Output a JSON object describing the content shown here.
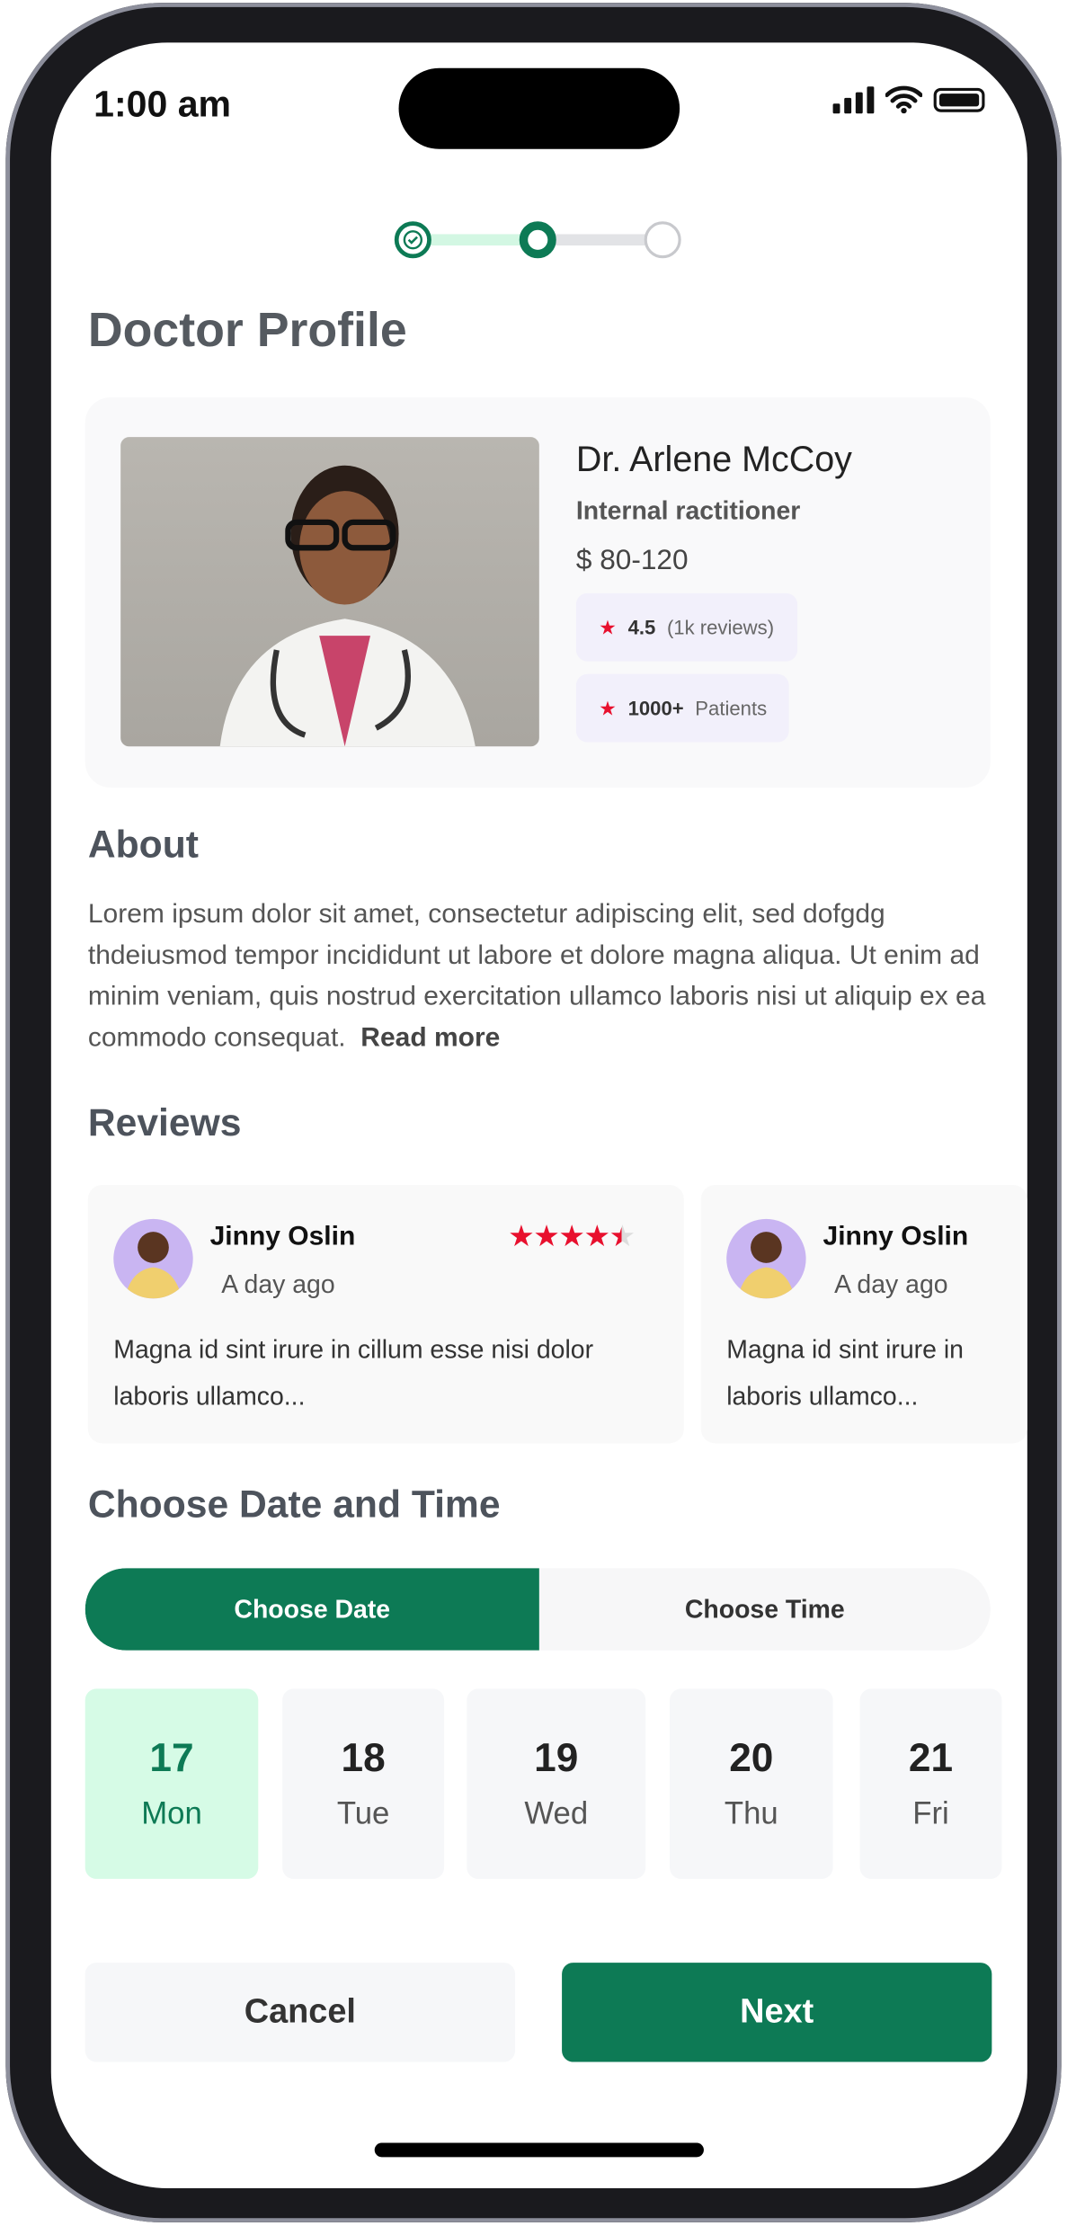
{
  "status_bar": {
    "time": "1:00 am"
  },
  "stepper": {
    "steps_total": 3,
    "current_step": 2,
    "accent": "#0d7a55"
  },
  "page": {
    "title": "Doctor Profile"
  },
  "doctor": {
    "name": "Dr. Arlene McCoy",
    "specialty": "Internal ractitioner",
    "price": "$ 80-120",
    "rating": "4.5",
    "reviews_label": "(1k reviews)",
    "patients": "1000+",
    "patients_label": "Patients"
  },
  "about": {
    "heading": "About",
    "text": "Lorem ipsum dolor sit amet, consectetur adipiscing elit, sed dofgdg thdeiusmod tempor incididunt ut labore et dolore magna aliqua. Ut enim ad minim veniam, quis nostrud exercitation ullamco laboris nisi ut aliquip ex ea commodo consequat.",
    "read_more": "Read more"
  },
  "reviews": {
    "heading": "Reviews",
    "items": [
      {
        "name": "Jinny Oslin",
        "time": "A day ago",
        "stars": 4.5,
        "text": "Magna id sint irure in cillum esse nisi dolor laboris ullamco..."
      },
      {
        "name": "Jinny Oslin",
        "time": "A day ago",
        "text": "Magna id sint irure in laboris ullamco..."
      }
    ]
  },
  "schedule": {
    "heading": "Choose Date and Time",
    "tab_date": "Choose Date",
    "tab_time": "Choose Time",
    "days": [
      {
        "num": "17",
        "day": "Mon",
        "selected": true
      },
      {
        "num": "18",
        "day": "Tue"
      },
      {
        "num": "19",
        "day": "Wed"
      },
      {
        "num": "20",
        "day": "Thu"
      },
      {
        "num": "21",
        "day": "Fri"
      }
    ]
  },
  "actions": {
    "cancel": "Cancel",
    "next": "Next"
  },
  "colors": {
    "primary": "#0d7a55",
    "selected_bg": "#d6fbe6",
    "star": "#e8102e"
  }
}
